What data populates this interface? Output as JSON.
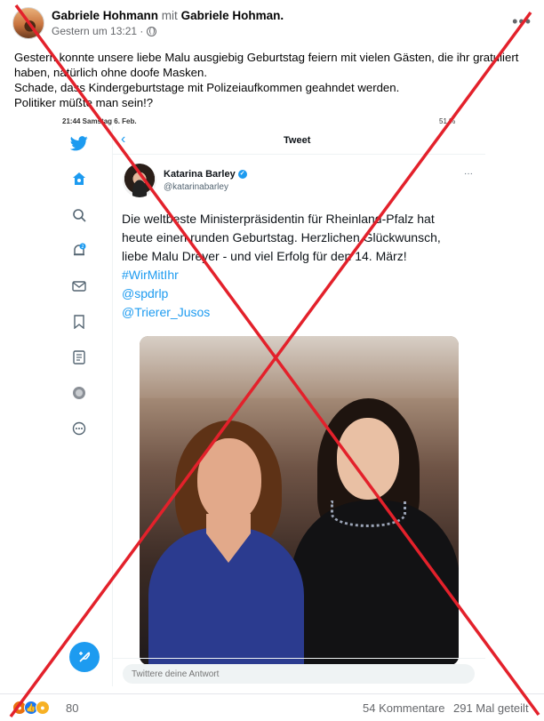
{
  "post": {
    "author": "Gabriele Hohmann",
    "with_word": "mit",
    "tagged": "Gabriele Hohman.",
    "time": "Gestern um 13:21 ·",
    "more": "•••",
    "text_lines": [
      "Gestern konnte unsere liebe Malu ausgiebig Geburtstag feiern mit vielen Gästen, die ihr gratuliert",
      "haben, natürlich ohne doofe Masken.",
      "Schade, dass Kindergeburtstage mit Polizeiaufkommen geahndet werden.",
      "Politiker müßte man sein!?"
    ]
  },
  "tweet_screenshot": {
    "status_time": "21:44  Samstag 6. Feb.",
    "status_right": "51 %",
    "title": "Tweet",
    "back": "‹",
    "author_name": "Katarina Barley",
    "author_handle": "@katarinabarley",
    "more": "···",
    "body_lines": [
      "Die weltbeste Ministerpräsidentin für Rheinland-Pfalz hat",
      "heute einen runden Geburtstag. Herzlichen Glückwunsch,",
      "liebe Malu Dreyer - und viel Erfolg für den 14. März!"
    ],
    "links": [
      "#WirMitIhr",
      "@spdrlp",
      "@Trierer_Jusos"
    ],
    "reply_placeholder": "Twittere deine Antwort",
    "notification_badge": "2",
    "sidebar_icons": [
      "twitter-logo-icon",
      "home-icon",
      "search-icon",
      "bell-icon",
      "mail-icon",
      "bookmark-icon",
      "list-icon",
      "profile-icon",
      "more-circle-icon"
    ]
  },
  "footer": {
    "reaction_count": "80",
    "comments": "54 Kommentare",
    "shares": "291 Mal geteilt"
  },
  "colors": {
    "twitter_blue": "#1d9bf0",
    "facebook_blue": "#1877f2",
    "cross_red": "#e3212b"
  }
}
